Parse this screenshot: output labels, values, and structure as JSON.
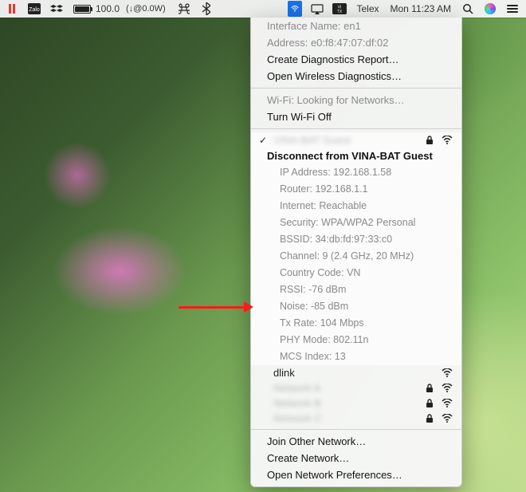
{
  "menubar": {
    "battery": {
      "percent": "100.0",
      "power": "(↓@0.0W)"
    },
    "input": "Telex",
    "clock": "Mon 11:23 AM",
    "input_badge": "VI TX"
  },
  "wifi": {
    "interface_label": "Interface Name:",
    "interface_value": "en1",
    "address_label": "Address:",
    "address_value": "e0:f8:47:07:df:02",
    "create_diag": "Create Diagnostics Report…",
    "open_diag": "Open Wireless Diagnostics…",
    "looking": "Wi-Fi: Looking for Networks…",
    "turn_off": "Turn Wi-Fi Off",
    "current_blurred": "VINA-BAT Guest",
    "disconnect": "Disconnect from VINA-BAT Guest",
    "details": {
      "ip": "IP Address: 192.168.1.58",
      "router": "Router: 192.168.1.1",
      "internet": "Internet: Reachable",
      "security": "Security: WPA/WPA2 Personal",
      "bssid": "BSSID: 34:db:fd:97:33:c0",
      "channel": "Channel: 9 (2.4 GHz, 20 MHz)",
      "country": "Country Code: VN",
      "rssi": "RSSI: -76 dBm",
      "noise": "Noise: -85 dBm",
      "txrate": "Tx Rate: 104 Mbps",
      "phy": "PHY Mode: 802.11n",
      "mcs": "MCS Index: 13"
    },
    "others": [
      {
        "name": "dlink",
        "locked": false,
        "blurred": false
      },
      {
        "name": "Network A",
        "locked": true,
        "blurred": true
      },
      {
        "name": "Network B",
        "locked": true,
        "blurred": true
      },
      {
        "name": "Network C",
        "locked": true,
        "blurred": true
      }
    ],
    "join_other": "Join Other Network…",
    "create_net": "Create Network…",
    "open_prefs": "Open Network Preferences…"
  }
}
